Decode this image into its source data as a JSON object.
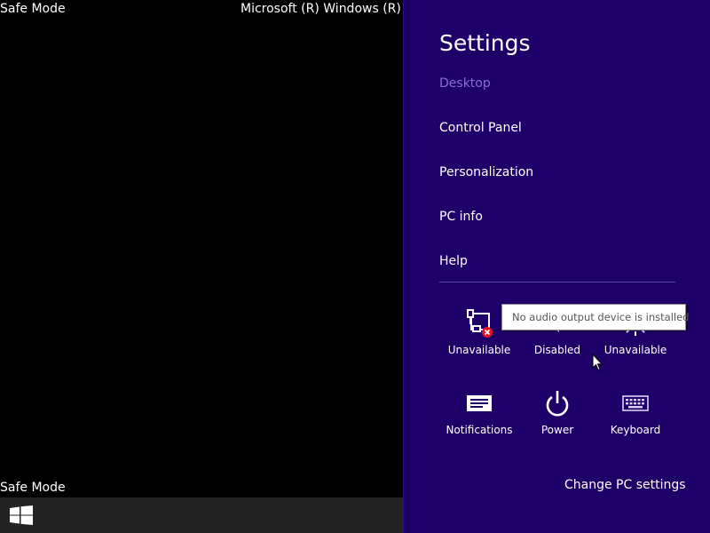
{
  "desktop": {
    "safe_mode_top": "Safe Mode",
    "version_text": "Microsoft (R) Windows (R) (",
    "safe_mode_bottom": "Safe Mode",
    "background_color": "#000000"
  },
  "taskbar": {
    "start_icon": "windows-logo-icon",
    "background_color": "#232323"
  },
  "settings": {
    "title": "Settings",
    "background_color": "#1f0068",
    "items": [
      {
        "label": "Desktop",
        "state": "dimmed"
      },
      {
        "label": "Control Panel"
      },
      {
        "label": "Personalization"
      },
      {
        "label": "PC info"
      },
      {
        "label": "Help"
      }
    ],
    "quick_tiles": [
      {
        "label": "Unavailable",
        "icon": "network-unavailable-icon"
      },
      {
        "label": "Disabled",
        "icon": "volume-icon"
      },
      {
        "label": "Unavailable",
        "icon": "brightness-icon"
      },
      {
        "label": "Notifications",
        "icon": "notifications-icon"
      },
      {
        "label": "Power",
        "icon": "power-icon"
      },
      {
        "label": "Keyboard",
        "icon": "keyboard-icon"
      }
    ],
    "change_pc_settings": "Change PC settings"
  },
  "tooltip": {
    "text": "No audio output device is installed"
  }
}
